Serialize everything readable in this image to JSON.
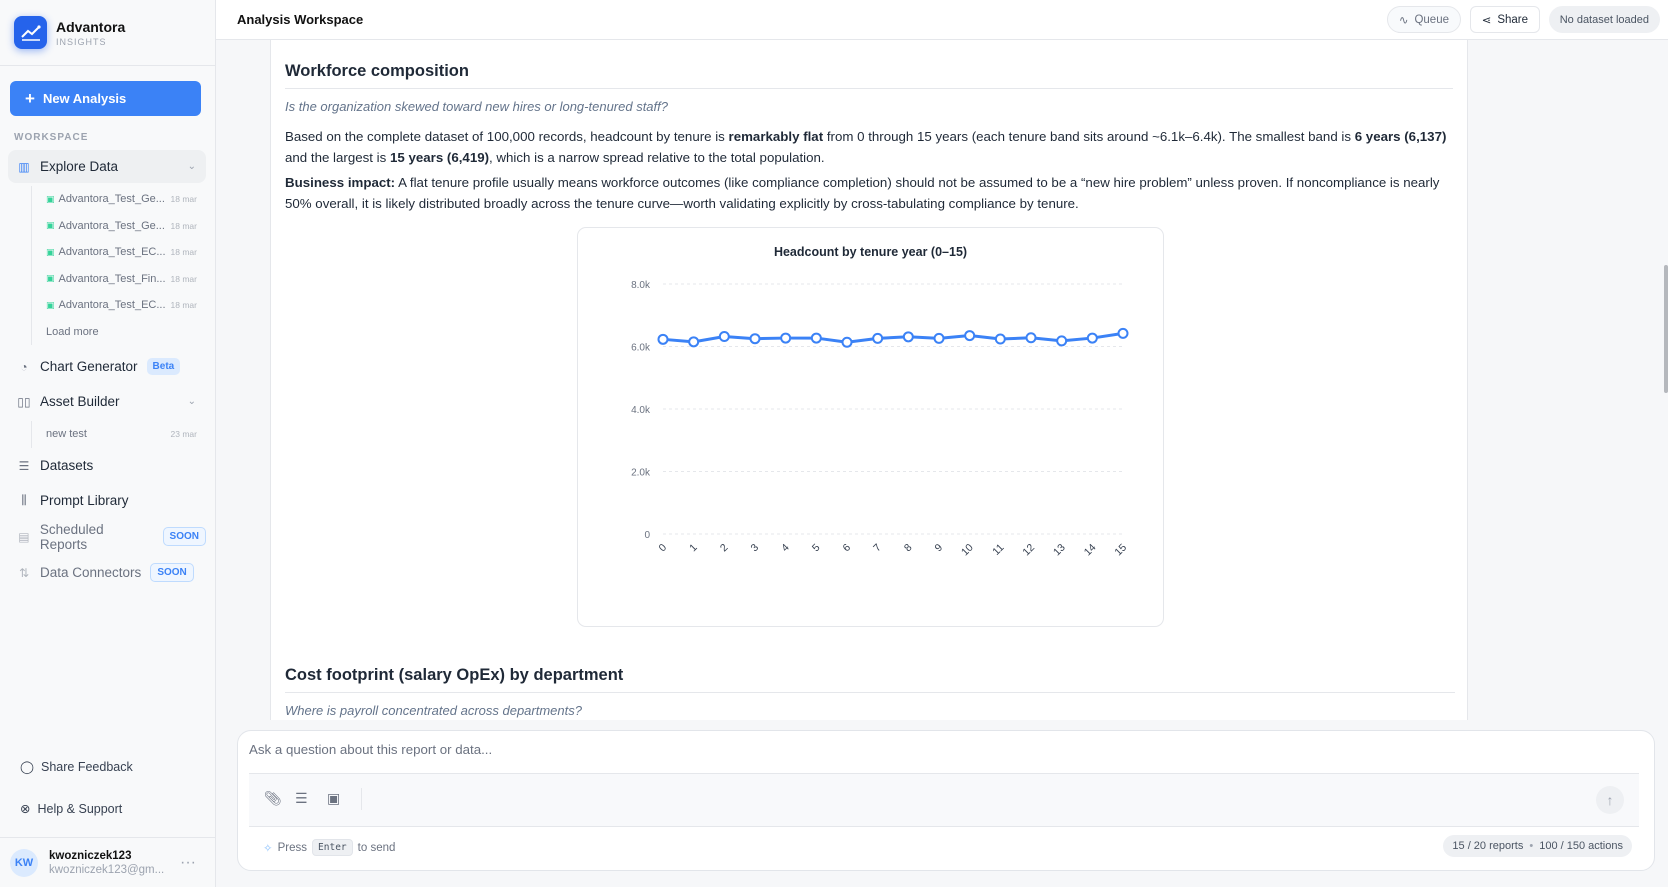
{
  "brand": {
    "name": "Advantora",
    "sub": "INSIGHTS"
  },
  "sidebar": {
    "new_analysis": "New Analysis",
    "section": "WORKSPACE",
    "explore": {
      "label": "Explore Data",
      "files": [
        {
          "name": "Advantora_Test_Ge...",
          "date": "18 mar"
        },
        {
          "name": "Advantora_Test_Ge...",
          "date": "18 mar"
        },
        {
          "name": "Advantora_Test_EC...",
          "date": "18 mar"
        },
        {
          "name": "Advantora_Test_Fin...",
          "date": "18 mar"
        },
        {
          "name": "Advantora_Test_EC...",
          "date": "18 mar"
        }
      ],
      "load_more": "Load more"
    },
    "chart_generator": {
      "label": "Chart Generator",
      "badge": "Beta"
    },
    "asset_builder": {
      "label": "Asset Builder",
      "items": [
        {
          "name": "new test",
          "date": "23 mar"
        }
      ]
    },
    "datasets": "Datasets",
    "prompt_library": "Prompt Library",
    "scheduled_reports": {
      "label": "Scheduled Reports",
      "badge": "SOON"
    },
    "data_connectors": {
      "label": "Data Connectors",
      "badge": "SOON"
    },
    "share_feedback": "Share Feedback",
    "help": "Help & Support",
    "user": {
      "initials": "KW",
      "name": "kwozniczek123",
      "email": "kwozniczek123@gm..."
    }
  },
  "header": {
    "title": "Analysis Workspace",
    "queue": "Queue",
    "share": "Share",
    "dataset": "No dataset loaded"
  },
  "report": {
    "section1": {
      "title": "Workforce composition",
      "question": "Is the organization skewed toward new hires or long-tenured staff?",
      "p1": [
        {
          "t": "Based on the complete dataset of 100,000 records, headcount by tenure is "
        },
        {
          "t": "remarkably flat",
          "b": true
        },
        {
          "t": " from 0 through 15 years (each tenure band sits around ~6.1k–6.4k). The smallest band is "
        },
        {
          "t": "6 years (6,137)",
          "b": true
        },
        {
          "t": " and the largest is "
        },
        {
          "t": "15 years (6,419)",
          "b": true
        },
        {
          "t": ", which is a narrow spread relative to the total population."
        }
      ],
      "p2": [
        {
          "t": "Business impact:",
          "b": true
        },
        {
          "t": " A flat tenure profile usually means workforce outcomes (like compliance completion) should not be assumed to be a “new hire problem” unless proven. If noncompliance is nearly 50% overall, it is likely distributed broadly across the tenure curve—worth validating explicitly by cross-tabulating compliance by tenure."
        }
      ]
    },
    "section2": {
      "title": "Cost footprint (salary OpEx) by department",
      "question": "Where is payroll concentrated across departments?"
    }
  },
  "chart_data": {
    "type": "line",
    "title": "Headcount by tenure year (0–15)",
    "xlabel": "",
    "ylabel": "",
    "x": [
      0,
      1,
      2,
      3,
      4,
      5,
      6,
      7,
      8,
      9,
      10,
      11,
      12,
      13,
      14,
      15
    ],
    "values": [
      6230,
      6150,
      6320,
      6250,
      6270,
      6270,
      6137,
      6260,
      6310,
      6260,
      6350,
      6240,
      6280,
      6180,
      6270,
      6419
    ],
    "ylim": [
      0,
      8000
    ],
    "yticks": [
      0,
      2000,
      4000,
      6000,
      8000
    ],
    "ytick_labels": [
      "0",
      "2.0k",
      "4.0k",
      "6.0k",
      "8.0k"
    ],
    "grid": true,
    "color": "#3b82f6"
  },
  "composer": {
    "placeholder": "Ask a question about this report or data...",
    "hint_press": "Press",
    "hint_key": "Enter",
    "hint_send": "to send",
    "reports": "15 / 20 reports",
    "actions": "100 / 150 actions"
  }
}
